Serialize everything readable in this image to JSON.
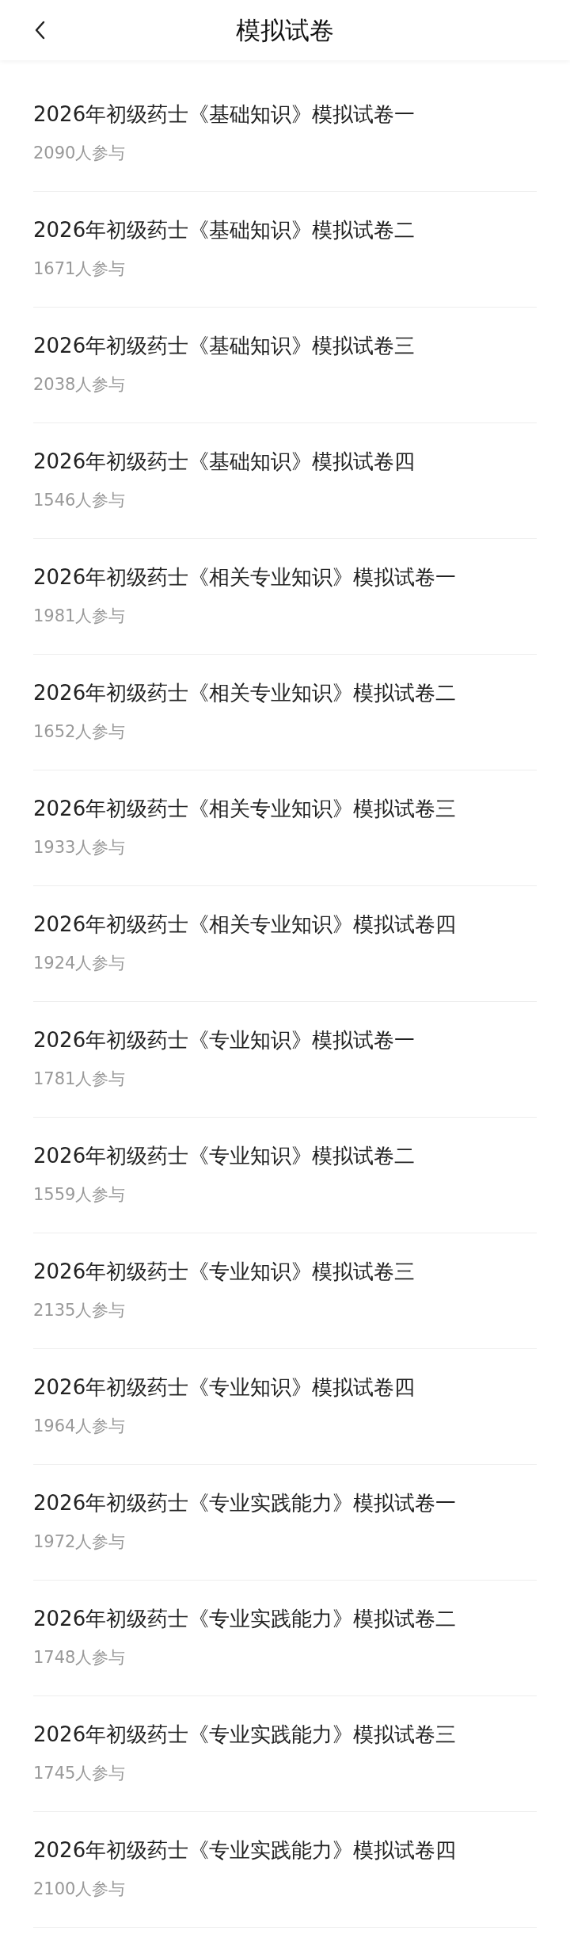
{
  "header": {
    "title": "模拟试卷"
  },
  "papers": [
    {
      "title": "2026年初级药士《基础知识》模拟试卷一",
      "participants": "2090人参与"
    },
    {
      "title": "2026年初级药士《基础知识》模拟试卷二",
      "participants": "1671人参与"
    },
    {
      "title": "2026年初级药士《基础知识》模拟试卷三",
      "participants": "2038人参与"
    },
    {
      "title": "2026年初级药士《基础知识》模拟试卷四",
      "participants": "1546人参与"
    },
    {
      "title": "2026年初级药士《相关专业知识》模拟试卷一",
      "participants": "1981人参与"
    },
    {
      "title": "2026年初级药士《相关专业知识》模拟试卷二",
      "participants": "1652人参与"
    },
    {
      "title": "2026年初级药士《相关专业知识》模拟试卷三",
      "participants": "1933人参与"
    },
    {
      "title": "2026年初级药士《相关专业知识》模拟试卷四",
      "participants": "1924人参与"
    },
    {
      "title": "2026年初级药士《专业知识》模拟试卷一",
      "participants": "1781人参与"
    },
    {
      "title": "2026年初级药士《专业知识》模拟试卷二",
      "participants": "1559人参与"
    },
    {
      "title": "2026年初级药士《专业知识》模拟试卷三",
      "participants": "2135人参与"
    },
    {
      "title": "2026年初级药士《专业知识》模拟试卷四",
      "participants": "1964人参与"
    },
    {
      "title": "2026年初级药士《专业实践能力》模拟试卷一",
      "participants": "1972人参与"
    },
    {
      "title": "2026年初级药士《专业实践能力》模拟试卷二",
      "participants": "1748人参与"
    },
    {
      "title": "2026年初级药士《专业实践能力》模拟试卷三",
      "participants": "1745人参与"
    },
    {
      "title": "2026年初级药士《专业实践能力》模拟试卷四",
      "participants": "2100人参与"
    }
  ]
}
